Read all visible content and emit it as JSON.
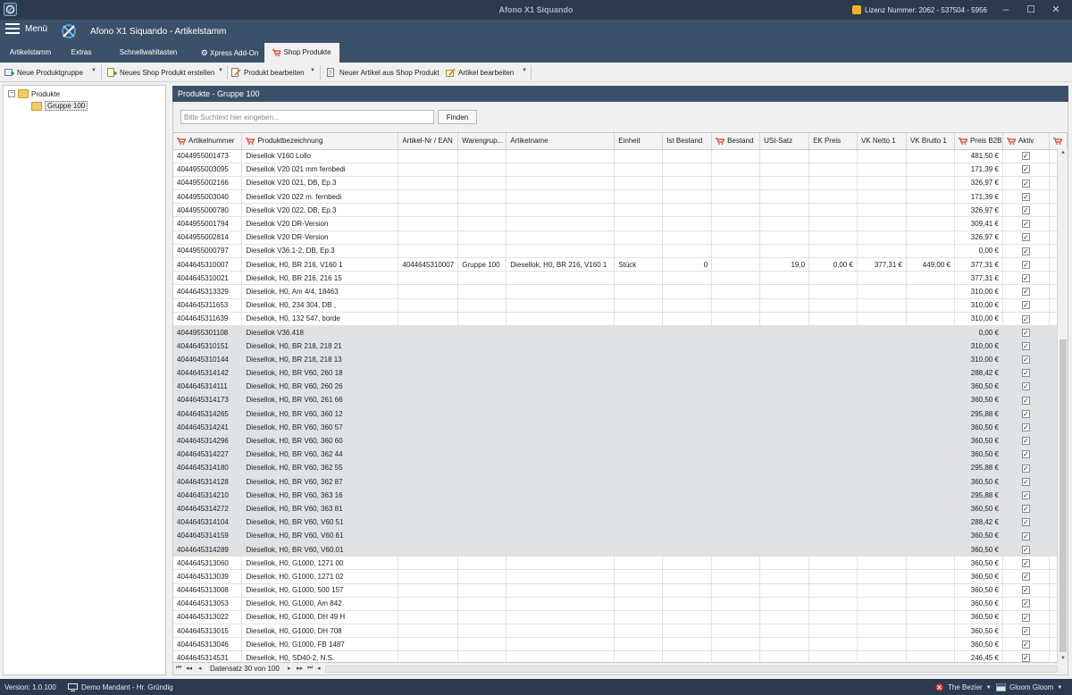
{
  "window": {
    "title": "Afono X1 Siquando",
    "license_text": "Lizenz Nummer: 2062 - 537504 - 5956",
    "minimize_glyph": "–",
    "maximize_glyph": "☐",
    "close_glyph": "✕"
  },
  "header": {
    "menu_label": "Menü",
    "title": "Afono X1 Siquando - Artikelstamm"
  },
  "tabs": [
    {
      "label": "Artikelstamm",
      "active": false
    },
    {
      "label": "Extras",
      "active": false
    },
    {
      "label": "Schnellwahltasten",
      "active": false
    },
    {
      "label": "Xpress Add-On",
      "active": false,
      "icon": "gear-icon"
    },
    {
      "label": "Shop Produkte",
      "active": true,
      "icon": "cart-icon"
    }
  ],
  "toolbar": {
    "new_product_group": "Neue Produktgruppe",
    "new_shop_product": "Neues Shop Produkt erstellen",
    "edit_product": "Produkt bearbeiten",
    "new_article_from_shop": "Neuer Artikel aus Shop Produkt",
    "edit_article": "Artikel bearbeiten"
  },
  "tree": {
    "root_label": "Produkte",
    "root_expander": "−",
    "child_label": "Gruppe 100"
  },
  "panel": {
    "title": "Produkte - Gruppe 100",
    "search_placeholder": "Bitte Suchtext hier eingeben...",
    "search_button": "Finden"
  },
  "grid": {
    "columns": [
      {
        "label": "Artikelnummer",
        "cart": true
      },
      {
        "label": "Produktbezeichnung",
        "cart": true
      },
      {
        "label": "Artikel-Nr / EAN",
        "cart": false
      },
      {
        "label": "Warengrup...",
        "cart": false
      },
      {
        "label": "Artikelname",
        "cart": false
      },
      {
        "label": "Einheit",
        "cart": false
      },
      {
        "label": "Ist Bestand",
        "cart": false
      },
      {
        "label": "Bestand",
        "cart": true
      },
      {
        "label": "USt-Satz",
        "cart": false
      },
      {
        "label": "EK Preis",
        "cart": false
      },
      {
        "label": "VK Netto 1",
        "cart": false
      },
      {
        "label": "VK Brutto 1",
        "cart": false
      },
      {
        "label": "Preis B2B",
        "cart": true
      },
      {
        "label": "Aktiv",
        "cart": true
      },
      {
        "label": "",
        "cart": true
      }
    ],
    "rows": [
      [
        "4044955001473",
        "Diesellok V160 Lollo",
        "",
        "",
        "",
        "",
        "",
        "",
        "",
        "",
        "",
        "",
        "481,50 €",
        "✓"
      ],
      [
        "4044955003095",
        "Diesellok V20 021 mm fernbedi",
        "",
        "",
        "",
        "",
        "",
        "",
        "",
        "",
        "",
        "",
        "171,39 €",
        "✓"
      ],
      [
        "4044955002166",
        "Diesellok V20 021, DB, Ep.3",
        "",
        "",
        "",
        "",
        "",
        "",
        "",
        "",
        "",
        "",
        "326,97 €",
        "✓"
      ],
      [
        "4044955003040",
        "Diesellok V20 022 m. fernbedi",
        "",
        "",
        "",
        "",
        "",
        "",
        "",
        "",
        "",
        "",
        "171,39 €",
        "✓"
      ],
      [
        "4044955000780",
        "Diesellok V20 022, DB, Ep.3",
        "",
        "",
        "",
        "",
        "",
        "",
        "",
        "",
        "",
        "",
        "326,97 €",
        "✓"
      ],
      [
        "4044955001794",
        "Diesellok V20 DR-Version",
        "",
        "",
        "",
        "",
        "",
        "",
        "",
        "",
        "",
        "",
        "309,41 €",
        "✓"
      ],
      [
        "4044955002814",
        "Diesellok V20 DR-Version",
        "",
        "",
        "",
        "",
        "",
        "",
        "",
        "",
        "",
        "",
        "326,97 €",
        "✓"
      ],
      [
        "4044955000797",
        "Diesellok V36.1-2, DB, Ep.3",
        "",
        "",
        "",
        "",
        "",
        "",
        "",
        "",
        "",
        "",
        "0,00 €",
        "✓"
      ],
      [
        "4044645310007",
        "Diesellok, H0, BR 216, V160 1",
        "4044645310007",
        "Gruppe 100",
        "Diesellok, H0, BR 216, V160 1",
        "Stück",
        "0",
        "",
        "19,0",
        "0,00 €",
        "377,31 €",
        "449,00 €",
        "377,31 €",
        "✓"
      ],
      [
        "4044645310021",
        "Diesellok, H0, BR 216, 216 15",
        "",
        "",
        "",
        "",
        "",
        "",
        "",
        "",
        "",
        "",
        "377,31 €",
        "✓"
      ],
      [
        "4044645313329",
        "Diesellok, H0, Am 4/4, 18463",
        "",
        "",
        "",
        "",
        "",
        "",
        "",
        "",
        "",
        "",
        "310,00 €",
        "✓"
      ],
      [
        "4044645311653",
        "Diesellok, H0, 234 304, DB ,",
        "",
        "",
        "",
        "",
        "",
        "",
        "",
        "",
        "",
        "",
        "310,00 €",
        "✓"
      ],
      [
        "4044645311639",
        "Diesellok, H0, 132 547, borde",
        "",
        "",
        "",
        "",
        "",
        "",
        "",
        "",
        "",
        "",
        "310,00 €",
        "✓"
      ],
      [
        "4044955301108",
        "Diesellok V36.418",
        "",
        "",
        "",
        "",
        "",
        "",
        "",
        "",
        "",
        "",
        "0,00 €",
        "✓"
      ],
      [
        "4044645310151",
        "Diesellok, H0, BR 218, 218 21",
        "",
        "",
        "",
        "",
        "",
        "",
        "",
        "",
        "",
        "",
        "310,00 €",
        "✓"
      ],
      [
        "4044645310144",
        "Diesellok, H0, BR 218, 218 13",
        "",
        "",
        "",
        "",
        "",
        "",
        "",
        "",
        "",
        "",
        "310,00 €",
        "✓"
      ],
      [
        "4044645314142",
        "Diesellok, H0, BR V60, 260 18",
        "",
        "",
        "",
        "",
        "",
        "",
        "",
        "",
        "",
        "",
        "288,42 €",
        "✓"
      ],
      [
        "4044645314111",
        "Diesellok, H0, BR V60, 260 26",
        "",
        "",
        "",
        "",
        "",
        "",
        "",
        "",
        "",
        "",
        "360,50 €",
        "✓"
      ],
      [
        "4044645314173",
        "Diesellok, H0, BR V60, 261 66",
        "",
        "",
        "",
        "",
        "",
        "",
        "",
        "",
        "",
        "",
        "360,50 €",
        "✓"
      ],
      [
        "4044645314265",
        "Diesellok, H0, BR V60, 360 12",
        "",
        "",
        "",
        "",
        "",
        "",
        "",
        "",
        "",
        "",
        "295,88 €",
        "✓"
      ],
      [
        "4044645314241",
        "Diesellok, H0, BR V60, 360 57",
        "",
        "",
        "",
        "",
        "",
        "",
        "",
        "",
        "",
        "",
        "360,50 €",
        "✓"
      ],
      [
        "4044645314296",
        "Diesellok, H0, BR V60, 360 60",
        "",
        "",
        "",
        "",
        "",
        "",
        "",
        "",
        "",
        "",
        "360,50 €",
        "✓"
      ],
      [
        "4044645314227",
        "Diesellok, H0, BR V60, 362 44",
        "",
        "",
        "",
        "",
        "",
        "",
        "",
        "",
        "",
        "",
        "360,50 €",
        "✓"
      ],
      [
        "4044645314180",
        "Diesellok, H0, BR V60, 362 55",
        "",
        "",
        "",
        "",
        "",
        "",
        "",
        "",
        "",
        "",
        "295,88 €",
        "✓"
      ],
      [
        "4044645314128",
        "Diesellok, H0, BR V60, 362 87",
        "",
        "",
        "",
        "",
        "",
        "",
        "",
        "",
        "",
        "",
        "360,50 €",
        "✓"
      ],
      [
        "4044645314210",
        "Diesellok, H0, BR V60, 363 16",
        "",
        "",
        "",
        "",
        "",
        "",
        "",
        "",
        "",
        "",
        "295,88 €",
        "✓"
      ],
      [
        "4044645314272",
        "Diesellok, H0, BR V60, 363 81",
        "",
        "",
        "",
        "",
        "",
        "",
        "",
        "",
        "",
        "",
        "360,50 €",
        "✓"
      ],
      [
        "4044645314104",
        "Diesellok, H0, BR V60, V60 51",
        "",
        "",
        "",
        "",
        "",
        "",
        "",
        "",
        "",
        "",
        "288,42 €",
        "✓"
      ],
      [
        "4044645314159",
        "Diesellok, H0, BR V60, V60 61",
        "",
        "",
        "",
        "",
        "",
        "",
        "",
        "",
        "",
        "",
        "360,50 €",
        "✓"
      ],
      [
        "4044645314289",
        "Diesellok, H0, BR V60, V60.01",
        "",
        "",
        "",
        "",
        "",
        "",
        "",
        "",
        "",
        "",
        "360,50 €",
        "✓"
      ],
      [
        "4044645313060",
        "Diesellok, H0, G1000, 1271 00",
        "",
        "",
        "",
        "",
        "",
        "",
        "",
        "",
        "",
        "",
        "360,50 €",
        "✓"
      ],
      [
        "4044645313039",
        "Diesellok, H0, G1000, 1271 02",
        "",
        "",
        "",
        "",
        "",
        "",
        "",
        "",
        "",
        "",
        "360,50 €",
        "✓"
      ],
      [
        "4044645313008",
        "Diesellok, H0, G1000, 500 157",
        "",
        "",
        "",
        "",
        "",
        "",
        "",
        "",
        "",
        "",
        "360,50 €",
        "✓"
      ],
      [
        "4044645313053",
        "Diesellok, H0, G1000, Am 842",
        "",
        "",
        "",
        "",
        "",
        "",
        "",
        "",
        "",
        "",
        "360,50 €",
        "✓"
      ],
      [
        "4044645313022",
        "Diesellok, H0, G1000, DH 49 H",
        "",
        "",
        "",
        "",
        "",
        "",
        "",
        "",
        "",
        "",
        "360,50 €",
        "✓"
      ],
      [
        "4044645313015",
        "Diesellok, H0, G1000, DH 708",
        "",
        "",
        "",
        "",
        "",
        "",
        "",
        "",
        "",
        "",
        "360,50 €",
        "✓"
      ],
      [
        "4044645313046",
        "Diesellok, H0, G1000, FB 1487",
        "",
        "",
        "",
        "",
        "",
        "",
        "",
        "",
        "",
        "",
        "360,50 €",
        "✓"
      ],
      [
        "4044645314531",
        "Diesellok, H0, SD40-2, N.S.",
        "",
        "",
        "",
        "",
        "",
        "",
        "",
        "",
        "",
        "",
        "246,45 €",
        "✓"
      ]
    ],
    "selected_rows_from": 13,
    "selected_rows_to": 29,
    "record_text": "Datensatz 30 von 100"
  },
  "navigator": {
    "first": "⏮",
    "prev_page": "◂◂",
    "prev": "◂",
    "next": "▸",
    "next_page": "▸▸",
    "last": "⏭",
    "scroll_left": "◂"
  },
  "status": {
    "version": "Version: 1.0.100",
    "mandant": "Demo Mandant - Hr. Gründig",
    "theme": "The Bezier",
    "skin": "Gloom Gloom"
  },
  "colors": {
    "titlebar": "#2b3a4e",
    "header": "#3b5169",
    "selection": "#dfe3e6",
    "cart_red": "#d93a2b"
  }
}
